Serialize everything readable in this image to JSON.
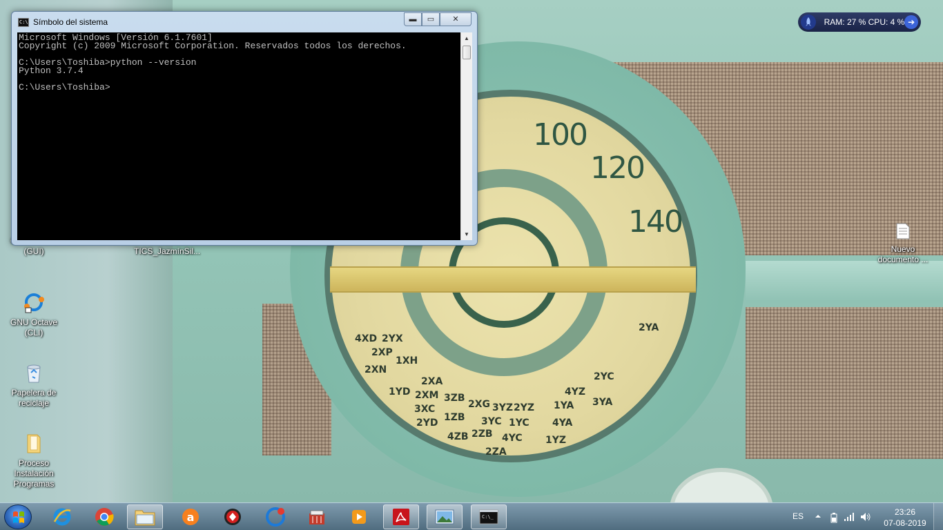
{
  "cmd_window": {
    "title": "Símbolo del sistema",
    "icon": "console-icon",
    "minimize_glyph": "▬",
    "maximize_glyph": "▭",
    "close_glyph": "✕",
    "console_lines": [
      "Microsoft Windows [Versión 6.1.7601]",
      "Copyright (c) 2009 Microsoft Corporation. Reservados todos los derechos.",
      "",
      "C:\\Users\\Toshiba>python --version",
      "Python 3.7.4",
      "",
      "C:\\Users\\Toshiba>"
    ]
  },
  "desktop_icons": [
    {
      "label": "GNU Octave (GUI)",
      "icon": "octave-icon"
    },
    {
      "label": "Desafío 0 TICS_JazmínSil...",
      "icon": "document-icon"
    },
    {
      "label": "GNU Octave (CLI)",
      "icon": "octave-icon"
    },
    {
      "label": "Papelera de reciclaje",
      "icon": "recycle-bin-icon"
    },
    {
      "label": "Proceso Instalación Programas",
      "icon": "folder-icon"
    },
    {
      "label": "Nuevo documento ...",
      "icon": "text-document-icon"
    }
  ],
  "gadget": {
    "text": "RAM: 27 %  CPU: 4 %",
    "icon": "rocket-icon",
    "arrow_icon": "arrow-right-icon"
  },
  "wallpaper": {
    "dial_numbers": [
      "100",
      "120",
      "140"
    ],
    "dial_stations": [
      "4XD",
      "2YX",
      "2XP",
      "1XH",
      "2XN",
      "2XA",
      "1YD",
      "2XM",
      "3ZB",
      "2XG",
      "3YZ",
      "2YZ",
      "3XC",
      "1ZB",
      "3YC",
      "1YC",
      "2YD",
      "4ZB",
      "2ZB",
      "4YC",
      "2ZA",
      "4YZ",
      "1YA",
      "4YA",
      "1YZ",
      "2YC",
      "3YA",
      "2YA"
    ]
  },
  "taskbar": {
    "items": [
      {
        "name": "internet-explorer-icon",
        "active": false
      },
      {
        "name": "chrome-icon",
        "active": false
      },
      {
        "name": "file-explorer-icon",
        "active": true
      },
      {
        "name": "avast-icon",
        "active": false
      },
      {
        "name": "red-app-icon",
        "active": false
      },
      {
        "name": "ccleaner-icon",
        "active": false
      },
      {
        "name": "media-app-icon",
        "active": false
      },
      {
        "name": "video-player-icon",
        "active": false
      },
      {
        "name": "adobe-reader-icon",
        "active": true
      },
      {
        "name": "image-viewer-icon",
        "active": true
      },
      {
        "name": "command-prompt-icon",
        "active": true
      }
    ],
    "language": "ES",
    "time": "23:26",
    "date": "07-08-2019",
    "colors": {
      "accent": "#2c64b6",
      "console_bg": "#000000",
      "console_fg": "#c0c0c0"
    }
  }
}
